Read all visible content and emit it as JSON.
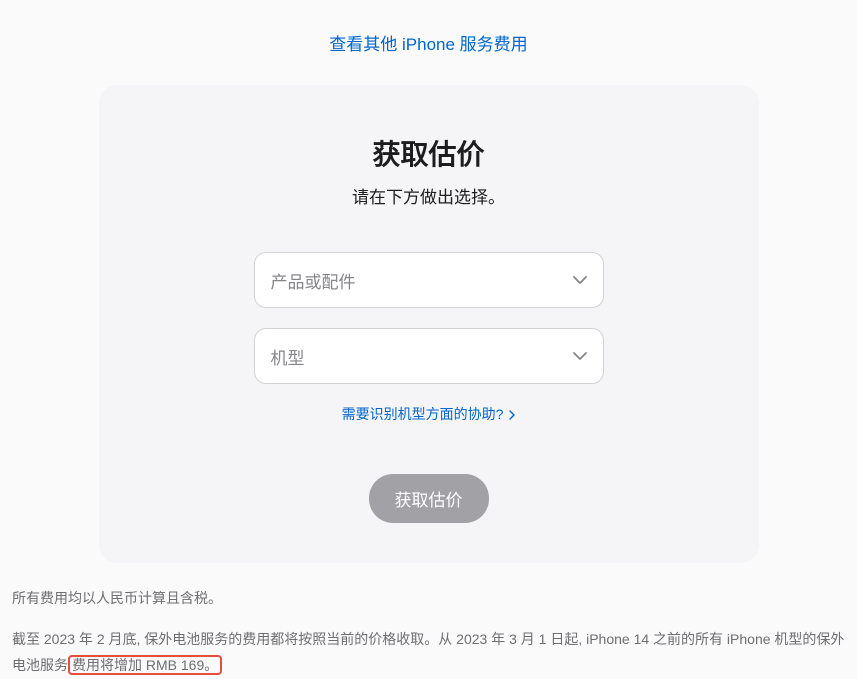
{
  "topLink": {
    "label": "查看其他 iPhone 服务费用"
  },
  "card": {
    "title": "获取估价",
    "subtitle": "请在下方做出选择。",
    "selects": {
      "product": {
        "placeholder": "产品或配件"
      },
      "model": {
        "placeholder": "机型"
      }
    },
    "helpLink": {
      "label": "需要识别机型方面的协助?"
    },
    "submitButton": {
      "label": "获取估价"
    }
  },
  "footer": {
    "line1": "所有费用均以人民币计算且含税。",
    "line2_part1": "截至 2023 年 2 月底, 保外电池服务的费用都将按照当前的价格收取。从 2023 年 3 月 1 日起, iPhone 14 之前的所有 iPhone 机型的保外电池服务",
    "line2_highlight": "费用将增加 RMB 169。"
  }
}
